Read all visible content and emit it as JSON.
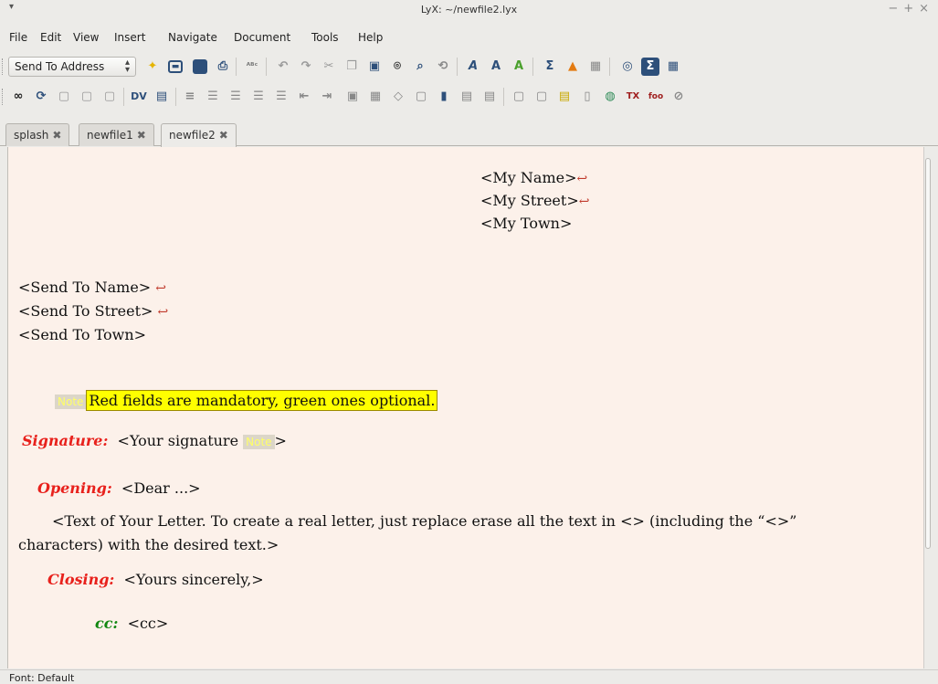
{
  "window": {
    "title": "LyX: ~/newfile2.lyx"
  },
  "menu": [
    {
      "label": "File"
    },
    {
      "label": "Edit"
    },
    {
      "label": "View"
    },
    {
      "label": "Insert"
    },
    {
      "label": "Navigate"
    },
    {
      "label": "Document"
    },
    {
      "label": "Tools"
    },
    {
      "label": "Help"
    }
  ],
  "toolbar": {
    "layout_combo": "Send To Address"
  },
  "tabs": [
    {
      "label": "splash"
    },
    {
      "label": "newfile1"
    },
    {
      "label": "newfile2"
    }
  ],
  "document": {
    "sender_name": "<My Name>",
    "sender_street": "<My Street>",
    "sender_town": "<My Town>",
    "recipient_name": "<Send To Name>",
    "recipient_street": "<Send To Street>",
    "recipient_town": "<Send To Town>",
    "note_label": "Note",
    "note_text": "Red fields are mandatory, green ones optional.",
    "signature_label": "Signature:",
    "signature_value": "<Your signature",
    "signature_close": ">",
    "opening_label": "Opening:",
    "opening_value": "<Dear ...>",
    "body_line1": "<Text of Your Letter. To create a real letter, just replace erase all the text in <> (including the “<>”",
    "body_line2": "characters) with the desired text.>",
    "closing_label": "Closing:",
    "closing_value": "<Yours sincerely,>",
    "cc_label": "cc:",
    "cc_value": "<cc>",
    "return_glyph": "↩"
  },
  "status": {
    "text": "Font: Default"
  },
  "colors": {
    "mandatory": "#e8211c",
    "optional": "#118711",
    "note_highlight": "#ffff00",
    "page_bg": "#fcf1ea"
  }
}
